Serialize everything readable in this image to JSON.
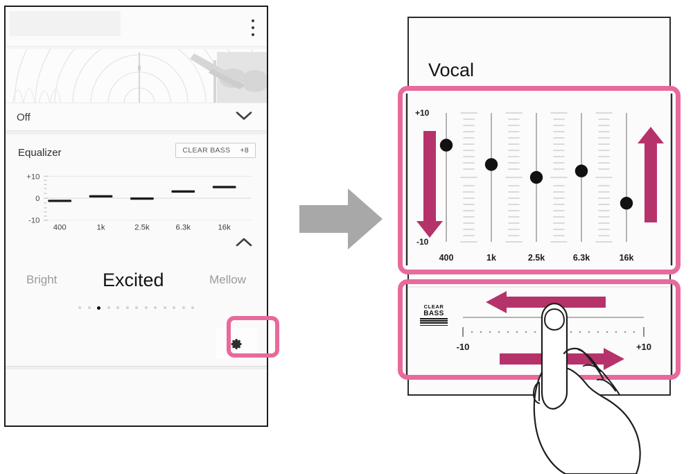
{
  "left_panel": {
    "overflow_menu_icon": "more-vertical-icon",
    "sound_effect": {
      "value": "Off",
      "chevron_icon": "chevron-down-icon"
    },
    "equalizer": {
      "title": "Equalizer",
      "clear_bass_label": "CLEAR BASS",
      "clear_bass_value": "+8",
      "collapse_icon": "chevron-up-icon"
    },
    "preset_carousel": {
      "previous": "Bright",
      "current": "Excited",
      "next": "Mellow",
      "dot_count": 13,
      "active_dot_index": 2
    },
    "settings_button": {
      "icon": "gear-icon",
      "highlight_color": "#e8699b"
    }
  },
  "flow": {
    "arrow_icon": "arrow-right-icon",
    "arrow_color": "#a8a8a8"
  },
  "right_panel": {
    "title": "Vocal",
    "eq_section": {
      "highlight_color": "#e8699b",
      "drag_down_arrow_icon": "arrow-down-icon",
      "drag_up_arrow_icon": "arrow-up-icon",
      "arrow_color": "#b5336a"
    },
    "clear_bass_section": {
      "logo_line1": "CLEAR",
      "logo_line2": "BASS",
      "logo_bar_count": 4,
      "min_label": "-10",
      "max_label": "+10",
      "drag_left_arrow_icon": "arrow-left-icon",
      "drag_right_arrow_icon": "arrow-right-icon",
      "arrow_color": "#b5336a",
      "highlight_color": "#e8699b",
      "hand_icon": "hand-pointing-icon"
    }
  },
  "chart_data": [
    {
      "type": "bar",
      "name": "mini-equalizer-preview",
      "title": "Equalizer",
      "categories": [
        "400",
        "1k",
        "2.5k",
        "6.3k",
        "16k"
      ],
      "values": [
        -1,
        1,
        0,
        3,
        5
      ],
      "xlabel": "",
      "ylabel": "",
      "ylim": [
        -10,
        10
      ],
      "ytick_labels": [
        "+10",
        "0",
        "-10"
      ],
      "grid": true
    },
    {
      "type": "bar",
      "name": "equalizer-sliders",
      "title": "Vocal",
      "categories": [
        "400",
        "1k",
        "2.5k",
        "6.3k",
        "16k"
      ],
      "values": [
        5,
        2,
        0,
        1,
        -4
      ],
      "xlabel": "",
      "ylabel": "",
      "ylim": [
        -10,
        10
      ],
      "ytick_labels": [
        "+10",
        "-10"
      ],
      "grid": false
    },
    {
      "type": "bar",
      "name": "clear-bass-slider",
      "categories": [
        "CLEAR BASS"
      ],
      "values": [
        1
      ],
      "xlabel": "",
      "ylabel": "",
      "ylim": [
        -10,
        10
      ],
      "ytick_labels": [
        "-10",
        "+10"
      ],
      "grid": false
    }
  ]
}
